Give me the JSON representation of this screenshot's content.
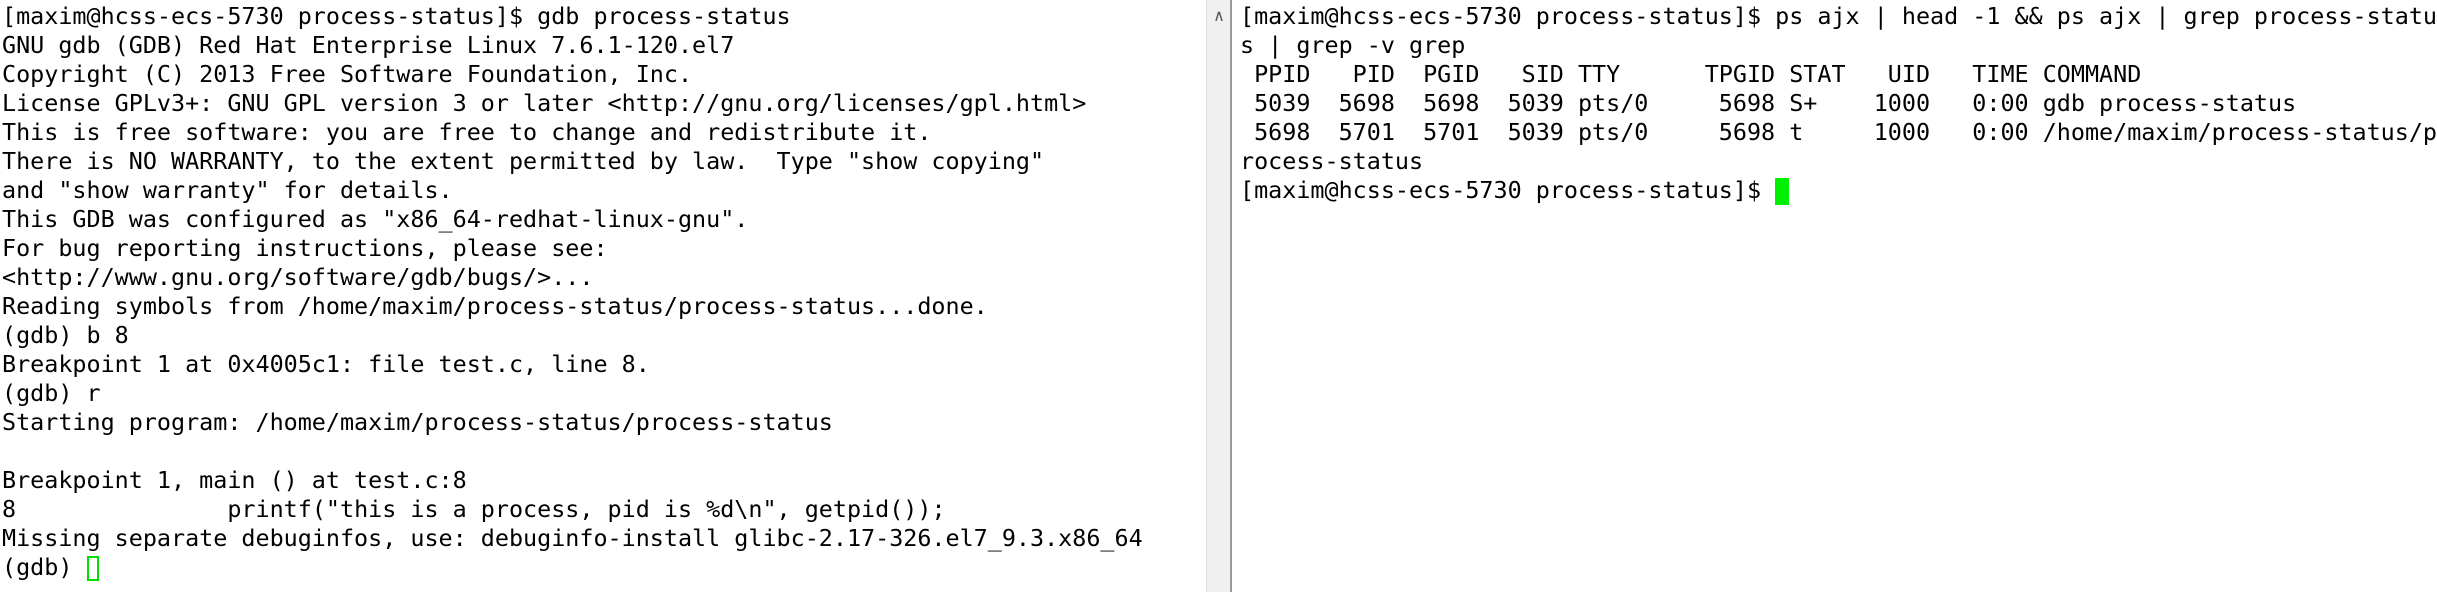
{
  "left_terminal": {
    "lines": [
      "[maxim@hcss-ecs-5730 process-status]$ gdb process-status",
      "GNU gdb (GDB) Red Hat Enterprise Linux 7.6.1-120.el7",
      "Copyright (C) 2013 Free Software Foundation, Inc.",
      "License GPLv3+: GNU GPL version 3 or later <http://gnu.org/licenses/gpl.html>",
      "This is free software: you are free to change and redistribute it.",
      "There is NO WARRANTY, to the extent permitted by law.  Type \"show copying\"",
      "and \"show warranty\" for details.",
      "This GDB was configured as \"x86_64-redhat-linux-gnu\".",
      "For bug reporting instructions, please see:",
      "<http://www.gnu.org/software/gdb/bugs/>...",
      "Reading symbols from /home/maxim/process-status/process-status...done.",
      "(gdb) b 8",
      "Breakpoint 1 at 0x4005c1: file test.c, line 8.",
      "(gdb) r",
      "Starting program: /home/maxim/process-status/process-status",
      "",
      "Breakpoint 1, main () at test.c:8",
      "8\t\tprintf(\"this is a process, pid is %d\\n\", getpid());",
      "Missing separate debuginfos, use: debuginfo-install glibc-2.17-326.el7_9.3.x86_64"
    ],
    "prompt": "(gdb) "
  },
  "right_terminal": {
    "lines": [
      "[maxim@hcss-ecs-5730 process-status]$ ps ajx | head -1 && ps ajx | grep process-statu",
      "s | grep -v grep",
      " PPID   PID  PGID   SID TTY      TPGID STAT   UID   TIME COMMAND",
      " 5039  5698  5698  5039 pts/0     5698 S+    1000   0:00 gdb process-status",
      " 5698  5701  5701  5039 pts/0     5698 t     1000   0:00 /home/maxim/process-status/p",
      "rocess-status"
    ],
    "prompt": "[maxim@hcss-ecs-5730 process-status]$ "
  },
  "colors": {
    "cursor": "#00f000",
    "background": "#ffffff",
    "text": "#000000"
  }
}
